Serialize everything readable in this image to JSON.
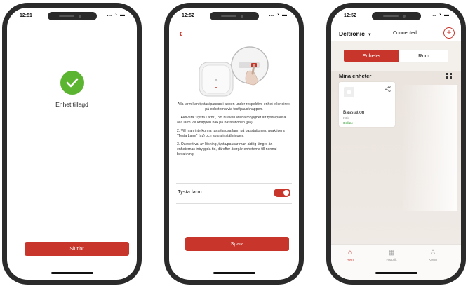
{
  "phone1": {
    "status_time": "12:51",
    "status_icons": "… ◔ ▬",
    "success_text": "Enhet tillagd",
    "finish_button": "Slutför"
  },
  "phone2": {
    "status_time": "12:52",
    "status_icons": "… ◔ ▬",
    "back": "‹",
    "intro": "Alla larm kan tystas/pausas i appen under respektive enhet eller direkt på enheterna via test/pausknappen.",
    "step1": "1.  Aktivera \"Tysta Larm\", om ni även vill ha möjlighet att tysta/pausa alla larm via knappen bak på basstationen (på).",
    "step2": "2.  Vill man inte kunna tysta/pausa larm på basstationen, avaktivera \"Tysta Larm\" (av) och spara inställningen.",
    "step3": "3.  Oavsett val av lösning, tysta/pausar man aldrig längre än enheternas inbyggda tid, därefter återgår enheterna till normal bevakning.",
    "toggle_label": "Tysta larm",
    "toggle_on": true,
    "save_button": "Spara"
  },
  "phone3": {
    "status_time": "12:52",
    "status_icons": "… ◔ ▬",
    "brand": "Deltronic",
    "connection": "Connected",
    "add": "+",
    "tabs": [
      "Enheter",
      "Rum"
    ],
    "section_title": "Mina enheter",
    "device": {
      "name": "Basstation",
      "room": "Kök",
      "status": "Online"
    },
    "bottom_nav": [
      {
        "label": "Hem",
        "icon": "home-icon"
      },
      {
        "label": "Historik",
        "icon": "history-icon"
      },
      {
        "label": "Konto",
        "icon": "account-icon"
      }
    ]
  },
  "colors": {
    "accent": "#c8362b",
    "success": "#5cb531",
    "online": "#3a9f36"
  }
}
